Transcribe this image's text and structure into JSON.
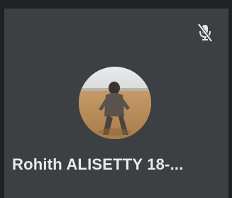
{
  "participant": {
    "display_name": "Rohith ALISETTY 18-...",
    "mic_status_icon": "mic-off-icon",
    "avatar_kind": "profile-photo"
  },
  "colors": {
    "tile_background": "#3c4043",
    "frame_background": "#202124",
    "name_text": "#e8eaed",
    "icon": "#e8eaed"
  }
}
